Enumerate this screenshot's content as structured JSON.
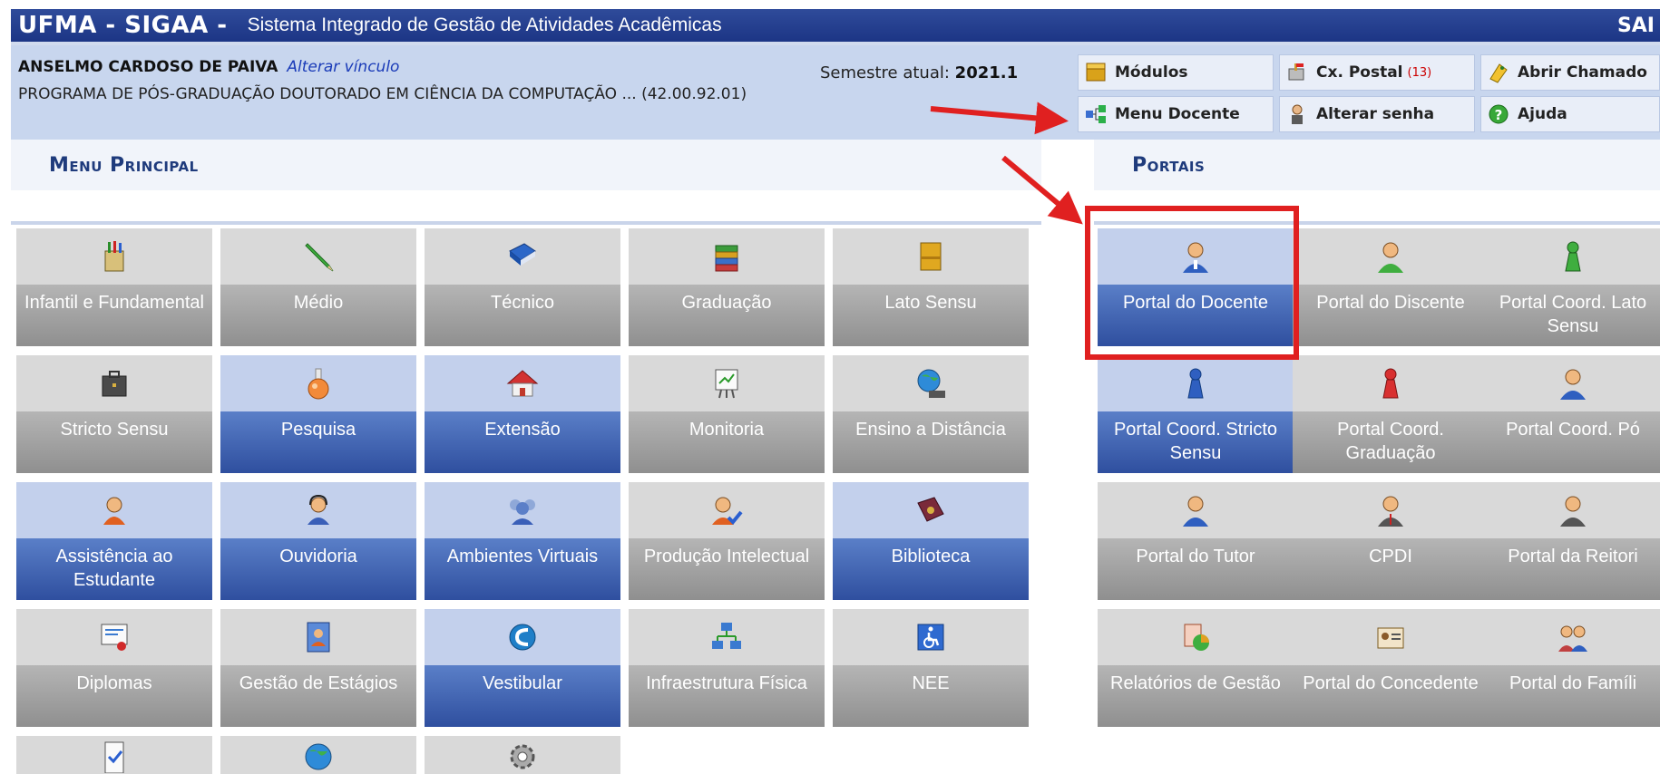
{
  "header": {
    "brand": "UFMA - SIGAA -",
    "subtitle": "Sistema Integrado de Gestão de Atividades Acadêmicas",
    "corner": "SAI"
  },
  "user": {
    "name": "ANSELMO CARDOSO DE PAIVA",
    "change_link": "Alterar vínculo",
    "program": "PROGRAMA DE PÓS-GRADUAÇÃO DOUTORADO EM CIÊNCIA DA COMPUTAÇÃO ... (42.00.92.01)",
    "semester_label": "Semestre atual:",
    "semester_value": "2021.1"
  },
  "quick": {
    "modulos": "Módulos",
    "cx_postal": "Cx. Postal",
    "cx_postal_count": "(13)",
    "abrir_chamado": "Abrir Chamado",
    "menu_docente": "Menu Docente",
    "alterar_senha": "Alterar senha",
    "ajuda": "Ajuda"
  },
  "sections": {
    "menu_principal": "Menu Principal",
    "portais": "Portais"
  },
  "menu": {
    "infantil": "Infantil e Fundamental",
    "medio": "Médio",
    "tecnico": "Técnico",
    "graduacao": "Graduação",
    "lato": "Lato Sensu",
    "stricto": "Stricto Sensu",
    "pesquisa": "Pesquisa",
    "extensao": "Extensão",
    "monitoria": "Monitoria",
    "ead": "Ensino a Distância",
    "assistencia": "Assistência ao Estudante",
    "ouvidoria": "Ouvidoria",
    "ambientes": "Ambientes Virtuais",
    "producao": "Produção Intelectual",
    "biblioteca": "Biblioteca",
    "diplomas": "Diplomas",
    "estagios": "Gestão de Estágios",
    "vestibular": "Vestibular",
    "infra": "Infraestrutura Física",
    "nee": "NEE"
  },
  "portais": {
    "docente": "Portal do Docente",
    "discente": "Portal do Discente",
    "coord_lato": "Portal Coord. Lato Sensu",
    "coord_stricto": "Portal Coord. Stricto Sensu",
    "coord_grad": "Portal Coord. Graduação",
    "coord_pos": "Portal Coord. Pó",
    "tutor": "Portal do Tutor",
    "cpdi": "CPDI",
    "reitoria": "Portal da Reitori",
    "relatorios": "Relatórios de Gestão",
    "concedente": "Portal do Concedente",
    "familia": "Portal do Famíli"
  }
}
